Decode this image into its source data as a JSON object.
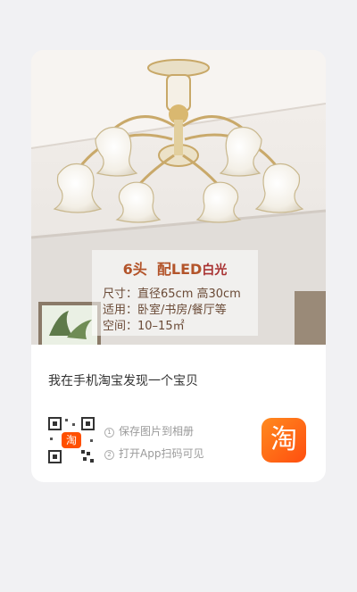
{
  "product_image": {
    "spec_head": "6头",
    "spec_led": "配LED",
    "spec_light": "白光",
    "size_line": "尺寸：直径65cm  高30cm",
    "use_line": "适用：卧室/书房/餐厅等",
    "space_line": "空间：10–15㎡"
  },
  "share": {
    "description": "我在手机淘宝发现一个宝贝",
    "qr_badge": "淘",
    "step1_num": "1",
    "step1": "保存图片到相册",
    "step2_num": "2",
    "step2": "打开App扫码可见",
    "app_icon_glyph": "淘"
  },
  "colors": {
    "brand_orange": "#ff5000",
    "background": "#f1f1f3"
  }
}
